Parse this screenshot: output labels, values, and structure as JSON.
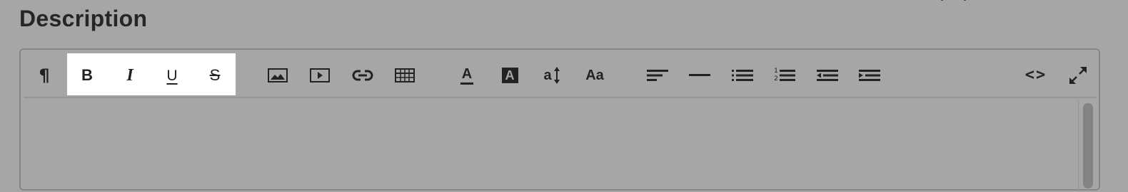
{
  "section": {
    "title": "Description"
  },
  "toolbar": {
    "paragraph": {
      "glyph": "¶",
      "icon": "paragraph-icon"
    },
    "bold": {
      "glyph": "B",
      "icon": "bold-icon"
    },
    "italic": {
      "glyph": "I",
      "icon": "italic-icon"
    },
    "underline": {
      "glyph": "U",
      "icon": "underline-icon"
    },
    "strikethrough": {
      "glyph": "S",
      "icon": "strikethrough-icon"
    },
    "image": {
      "icon": "image-icon"
    },
    "video": {
      "icon": "video-icon"
    },
    "link": {
      "icon": "link-icon"
    },
    "table": {
      "icon": "table-icon"
    },
    "text_color": {
      "glyph": "A",
      "icon": "text-color-icon"
    },
    "background_color": {
      "glyph": "A",
      "icon": "background-color-icon"
    },
    "line_height": {
      "glyph": "a",
      "icon": "line-height-icon"
    },
    "font_size": {
      "glyph": "Aa",
      "icon": "font-size-icon"
    },
    "align": {
      "icon": "align-left-icon"
    },
    "horizontal_rule": {
      "icon": "horizontal-rule-icon"
    },
    "bullet_list": {
      "icon": "bulleted-list-icon"
    },
    "numbered_list": {
      "icon": "numbered-list-icon",
      "glyph_1": "1",
      "glyph_2": "2"
    },
    "outdent": {
      "icon": "outdent-icon"
    },
    "indent": {
      "icon": "indent-icon"
    },
    "code_view": {
      "glyph": "<>",
      "icon": "code-view-icon"
    },
    "fullscreen": {
      "icon": "fullscreen-icon"
    }
  },
  "colors": {
    "page_background": "#a6a6a6",
    "icon": "#222222",
    "active_group": "#ffffff",
    "border": "#858585"
  }
}
